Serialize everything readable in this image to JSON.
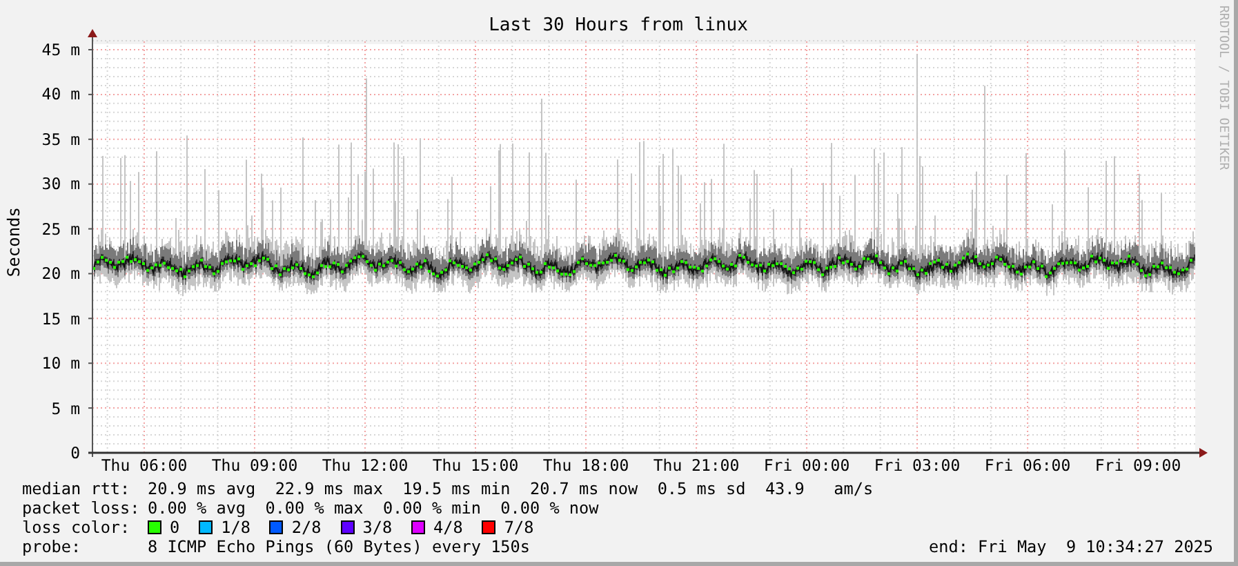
{
  "graph": {
    "title": "Last 30 Hours from linux",
    "ylabel": "Seconds",
    "signature": "RRDTOOL / TOBI OETIKER",
    "yticks": [
      "45 m",
      "40 m",
      "35 m",
      "30 m",
      "25 m",
      "20 m",
      "15 m",
      "10 m",
      "5 m",
      "0"
    ],
    "xticks": [
      "Thu 06:00",
      "Thu 09:00",
      "Thu 12:00",
      "Thu 15:00",
      "Thu 18:00",
      "Thu 21:00",
      "Fri 00:00",
      "Fri 03:00",
      "Fri 06:00",
      "Fri 09:00"
    ]
  },
  "legend": {
    "rows": [
      {
        "kind": "text",
        "label": "median rtt:",
        "text": "20.9 ms avg  22.9 ms max  19.5 ms min  20.7 ms now  0.5 ms sd  43.9   am/s"
      },
      {
        "kind": "text",
        "label": "packet loss:",
        "text": "0.00 % avg  0.00 % max  0.00 % min  0.00 % now"
      },
      {
        "kind": "swatches",
        "label": "loss color:",
        "items": [
          {
            "label": "0",
            "color": "#26ff00"
          },
          {
            "label": "1/8",
            "color": "#00b8ff"
          },
          {
            "label": "2/8",
            "color": "#0059ff"
          },
          {
            "label": "3/8",
            "color": "#5e00ff"
          },
          {
            "label": "4/8",
            "color": "#dd00ff"
          },
          {
            "label": "7/8",
            "color": "#ff0000"
          }
        ]
      },
      {
        "kind": "text",
        "label": "probe:",
        "text": "8 ICMP Echo Pings (60 Bytes) every 150s"
      }
    ],
    "end": "end: Fri May  9 10:34:27 2025"
  }
}
